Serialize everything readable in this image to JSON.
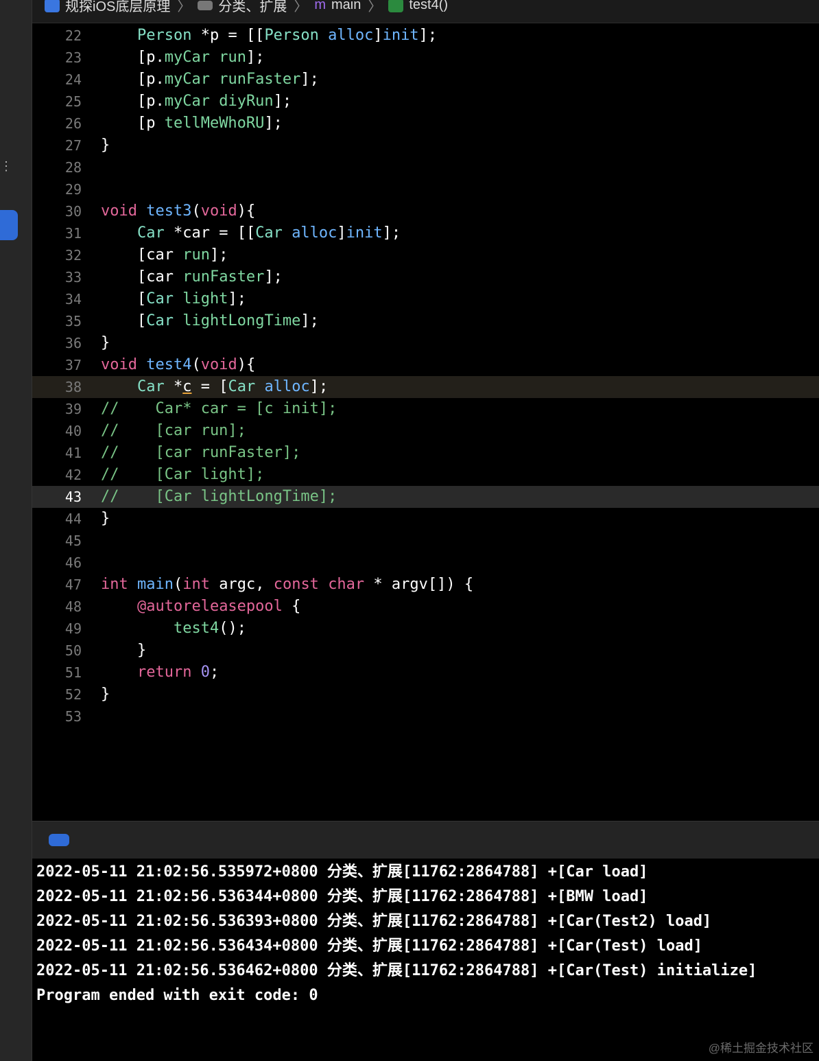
{
  "breadcrumb": {
    "items": [
      "规探iOS底层原理",
      "分类、扩展",
      "main",
      "test4()"
    ],
    "separator": "〉"
  },
  "sidebar": {
    "tick": "⋮"
  },
  "editor": {
    "lines": [
      {
        "n": "22",
        "hl": "",
        "tokens": [
          [
            "    ",
            "pl"
          ],
          [
            "Person",
            "type"
          ],
          [
            " *p = [[",
            "pl"
          ],
          [
            "Person",
            "type"
          ],
          [
            " ",
            "pl"
          ],
          [
            "alloc",
            "fn"
          ],
          [
            "]",
            "pl"
          ],
          [
            "init",
            "fn"
          ],
          [
            "];",
            "pl"
          ]
        ]
      },
      {
        "n": "23",
        "hl": "",
        "tokens": [
          [
            "    [p.",
            "pl"
          ],
          [
            "myCar",
            "call"
          ],
          [
            " ",
            "pl"
          ],
          [
            "run",
            "call"
          ],
          [
            "];",
            "pl"
          ]
        ]
      },
      {
        "n": "24",
        "hl": "",
        "tokens": [
          [
            "    [p.",
            "pl"
          ],
          [
            "myCar",
            "call"
          ],
          [
            " ",
            "pl"
          ],
          [
            "runFaster",
            "call"
          ],
          [
            "];",
            "pl"
          ]
        ]
      },
      {
        "n": "25",
        "hl": "",
        "tokens": [
          [
            "    [p.",
            "pl"
          ],
          [
            "myCar",
            "call"
          ],
          [
            " ",
            "pl"
          ],
          [
            "diyRun",
            "call"
          ],
          [
            "];",
            "pl"
          ]
        ]
      },
      {
        "n": "26",
        "hl": "",
        "tokens": [
          [
            "    [p ",
            "pl"
          ],
          [
            "tellMeWhoRU",
            "call"
          ],
          [
            "];",
            "pl"
          ]
        ]
      },
      {
        "n": "27",
        "hl": "",
        "tokens": [
          [
            "}",
            "pl"
          ]
        ]
      },
      {
        "n": "28",
        "hl": "",
        "tokens": []
      },
      {
        "n": "29",
        "hl": "",
        "tokens": []
      },
      {
        "n": "30",
        "hl": "",
        "tokens": [
          [
            "void",
            "kw"
          ],
          [
            " ",
            "pl"
          ],
          [
            "test3",
            "fn"
          ],
          [
            "(",
            "pl"
          ],
          [
            "void",
            "kw"
          ],
          [
            "){",
            "pl"
          ]
        ]
      },
      {
        "n": "31",
        "hl": "",
        "tokens": [
          [
            "    ",
            "pl"
          ],
          [
            "Car",
            "type"
          ],
          [
            " *car = [[",
            "pl"
          ],
          [
            "Car",
            "type"
          ],
          [
            " ",
            "pl"
          ],
          [
            "alloc",
            "fn"
          ],
          [
            "]",
            "pl"
          ],
          [
            "init",
            "fn"
          ],
          [
            "];",
            "pl"
          ]
        ]
      },
      {
        "n": "32",
        "hl": "",
        "tokens": [
          [
            "    [car ",
            "pl"
          ],
          [
            "run",
            "call"
          ],
          [
            "];",
            "pl"
          ]
        ]
      },
      {
        "n": "33",
        "hl": "",
        "tokens": [
          [
            "    [car ",
            "pl"
          ],
          [
            "runFaster",
            "call"
          ],
          [
            "];",
            "pl"
          ]
        ]
      },
      {
        "n": "34",
        "hl": "",
        "tokens": [
          [
            "    [",
            "pl"
          ],
          [
            "Car",
            "type"
          ],
          [
            " ",
            "pl"
          ],
          [
            "light",
            "call"
          ],
          [
            "];",
            "pl"
          ]
        ]
      },
      {
        "n": "35",
        "hl": "",
        "tokens": [
          [
            "    [",
            "pl"
          ],
          [
            "Car",
            "type"
          ],
          [
            " ",
            "pl"
          ],
          [
            "lightLongTime",
            "call"
          ],
          [
            "];",
            "pl"
          ]
        ]
      },
      {
        "n": "36",
        "hl": "",
        "tokens": [
          [
            "}",
            "pl"
          ]
        ]
      },
      {
        "n": "37",
        "hl": "",
        "tokens": [
          [
            "void",
            "kw"
          ],
          [
            " ",
            "pl"
          ],
          [
            "test4",
            "fn"
          ],
          [
            "(",
            "pl"
          ],
          [
            "void",
            "kw"
          ],
          [
            "){",
            "pl"
          ]
        ]
      },
      {
        "n": "38",
        "hl": "hl1",
        "tokens": [
          [
            "    ",
            "pl"
          ],
          [
            "Car",
            "type"
          ],
          [
            " *",
            "pl"
          ],
          [
            "c",
            "u"
          ],
          [
            " = [",
            "pl"
          ],
          [
            "Car",
            "type"
          ],
          [
            " ",
            "pl"
          ],
          [
            "alloc",
            "fn"
          ],
          [
            "];",
            "pl"
          ]
        ]
      },
      {
        "n": "39",
        "hl": "",
        "tokens": [
          [
            "//    Car* car = [c init];",
            "cmt"
          ]
        ]
      },
      {
        "n": "40",
        "hl": "",
        "tokens": [
          [
            "//    [car run];",
            "cmt"
          ]
        ]
      },
      {
        "n": "41",
        "hl": "",
        "tokens": [
          [
            "//    [car runFaster];",
            "cmt"
          ]
        ]
      },
      {
        "n": "42",
        "hl": "",
        "tokens": [
          [
            "//    [Car light];",
            "cmt"
          ]
        ]
      },
      {
        "n": "43",
        "hl": "hl2",
        "tokens": [
          [
            "//    [Car lightLongTime];",
            "cmt"
          ]
        ]
      },
      {
        "n": "44",
        "hl": "",
        "tokens": [
          [
            "}",
            "pl"
          ]
        ]
      },
      {
        "n": "45",
        "hl": "",
        "tokens": []
      },
      {
        "n": "46",
        "hl": "",
        "tokens": []
      },
      {
        "n": "47",
        "hl": "",
        "tokens": [
          [
            "int",
            "kw"
          ],
          [
            " ",
            "pl"
          ],
          [
            "main",
            "fn"
          ],
          [
            "(",
            "pl"
          ],
          [
            "int",
            "kw"
          ],
          [
            " argc, ",
            "pl"
          ],
          [
            "const",
            "kw"
          ],
          [
            " ",
            "pl"
          ],
          [
            "char",
            "kw"
          ],
          [
            " * argv[]) {",
            "pl"
          ]
        ]
      },
      {
        "n": "48",
        "hl": "",
        "tokens": [
          [
            "    ",
            "pl"
          ],
          [
            "@autoreleasepool",
            "kw"
          ],
          [
            " {",
            "pl"
          ]
        ]
      },
      {
        "n": "49",
        "hl": "",
        "tokens": [
          [
            "        ",
            "pl"
          ],
          [
            "test4",
            "call"
          ],
          [
            "();",
            "pl"
          ]
        ]
      },
      {
        "n": "50",
        "hl": "",
        "tokens": [
          [
            "    }",
            "pl"
          ]
        ]
      },
      {
        "n": "51",
        "hl": "",
        "tokens": [
          [
            "    ",
            "pl"
          ],
          [
            "return",
            "kw"
          ],
          [
            " ",
            "pl"
          ],
          [
            "0",
            "num"
          ],
          [
            ";",
            "pl"
          ]
        ]
      },
      {
        "n": "52",
        "hl": "",
        "tokens": [
          [
            "}",
            "pl"
          ]
        ]
      },
      {
        "n": "53",
        "hl": "",
        "tokens": []
      }
    ]
  },
  "console": {
    "lines": [
      "2022-05-11 21:02:56.535972+0800 分类、扩展[11762:2864788] +[Car load]",
      "2022-05-11 21:02:56.536344+0800 分类、扩展[11762:2864788] +[BMW load]",
      "2022-05-11 21:02:56.536393+0800 分类、扩展[11762:2864788] +[Car(Test2) load]",
      "2022-05-11 21:02:56.536434+0800 分类、扩展[11762:2864788] +[Car(Test) load]",
      "2022-05-11 21:02:56.536462+0800 分类、扩展[11762:2864788] +[Car(Test) initialize]",
      "Program ended with exit code: 0"
    ]
  },
  "watermark": "@稀土掘金技术社区",
  "colors": {
    "accent": "#2f6bd7",
    "type": "#86e0c6",
    "keyword": "#e3679a",
    "function": "#6fb6ff",
    "call": "#7fd7a1",
    "comment": "#79c486",
    "number": "#a694f5"
  }
}
